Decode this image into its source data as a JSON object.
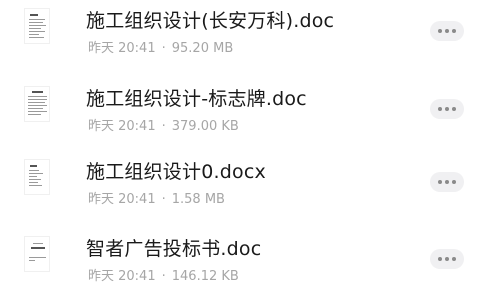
{
  "files": [
    {
      "name": "施工组织设计(长安万科).doc",
      "date": "昨天 20:41",
      "size": "95.20 MB",
      "icon": "doc-thumbnail-icon"
    },
    {
      "name": "施工组织设计-标志牌.doc",
      "date": "昨天 20:41",
      "size": "379.00 KB",
      "icon": "doc-thumbnail-icon"
    },
    {
      "name": "施工组织设计0.docx",
      "date": "昨天 20:41",
      "size": "1.58 MB",
      "icon": "doc-thumbnail-icon"
    },
    {
      "name": "智者广告投标书.doc",
      "date": "昨天 20:41",
      "size": "146.12 KB",
      "icon": "doc-thumbnail-icon"
    }
  ],
  "meta_separator": "·",
  "more_icon": "more-dots-icon"
}
